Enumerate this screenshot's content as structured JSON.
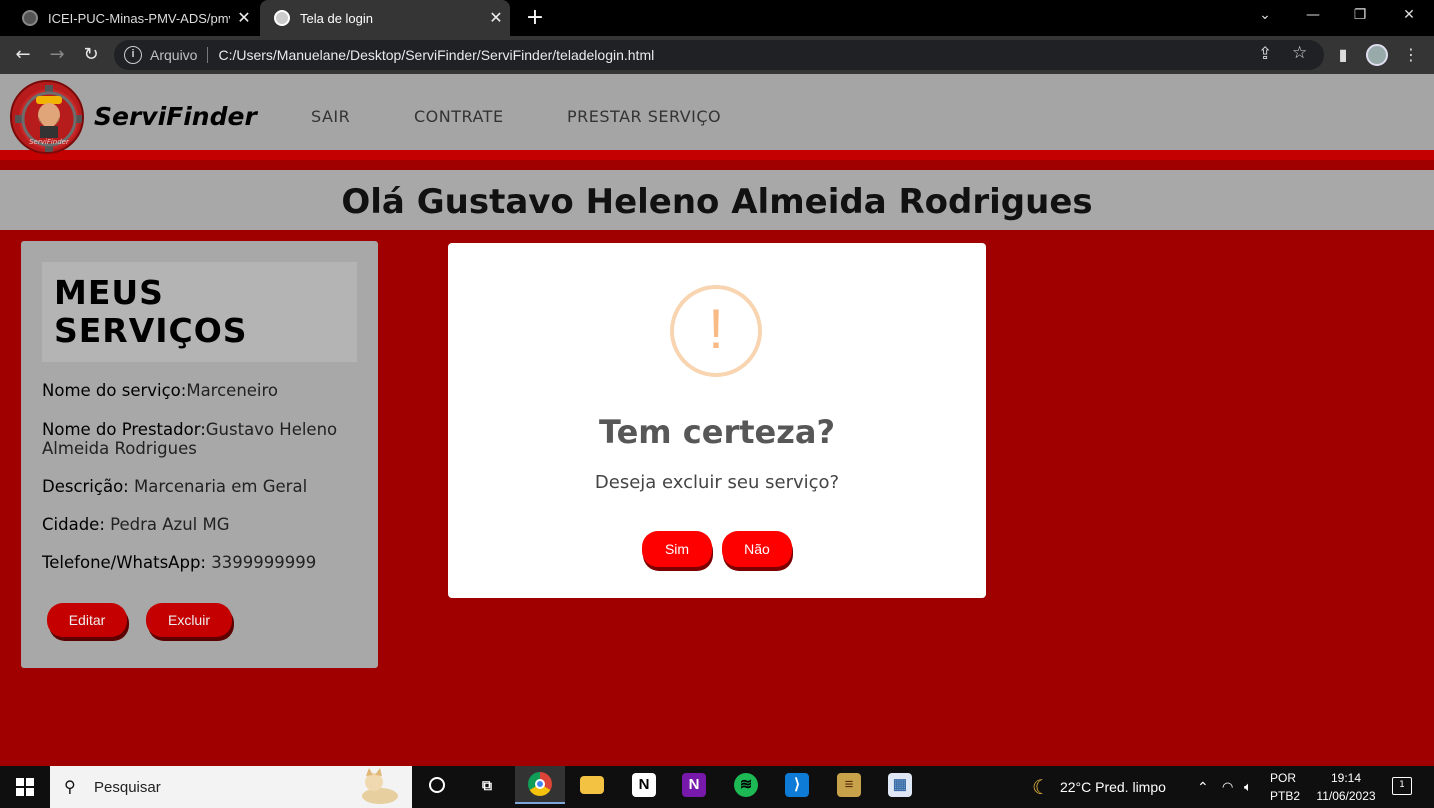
{
  "browser": {
    "tabs": [
      {
        "title": "ICEI-PUC-Minas-PMV-ADS/pmv-",
        "active": false
      },
      {
        "title": "Tela de login",
        "active": true
      }
    ],
    "address_scheme": "Arquivo",
    "address_url": "C:/Users/Manuelane/Desktop/ServiFinder/ServiFinder/teladelogin.html"
  },
  "site": {
    "brand": "ServiFinder",
    "logo_text": "ServiFinder",
    "nav": [
      "SAIR",
      "CONTRATE",
      "PRESTAR SERVIÇO"
    ],
    "greeting": "Olá Gustavo Heleno Almeida Rodrigues"
  },
  "service_card": {
    "title": "MEUS SERVIÇOS",
    "fields": [
      {
        "label": "Nome do serviço:",
        "value": "Marceneiro"
      },
      {
        "label": "Nome do Prestador:",
        "value": "Gustavo Heleno Almeida Rodrigues"
      },
      {
        "label": "Descrição:",
        "value": " Marcenaria em Geral"
      },
      {
        "label": "Cidade:",
        "value": " Pedra Azul MG"
      },
      {
        "label": "Telefone/WhatsApp:",
        "value": " 3399999999"
      }
    ],
    "edit_label": "Editar",
    "delete_label": "Excluir"
  },
  "modal": {
    "icon": "!",
    "title": "Tem certeza?",
    "text": "Deseja excluir seu serviço?",
    "confirm_label": "Sim",
    "cancel_label": "Não"
  },
  "taskbar": {
    "search_placeholder": "Pesquisar",
    "weather": "22°C  Pred. limpo",
    "lang_line1": "POR",
    "lang_line2": "PTB2",
    "time": "19:14",
    "date": "11/06/2023",
    "notifications": "1"
  },
  "colors": {
    "page_bg": "#a00000",
    "header_bg": "#a5a5a5",
    "accent_red": "#c50000",
    "modal_button": "#ff0000",
    "warning_orange": "#f8bb86"
  }
}
